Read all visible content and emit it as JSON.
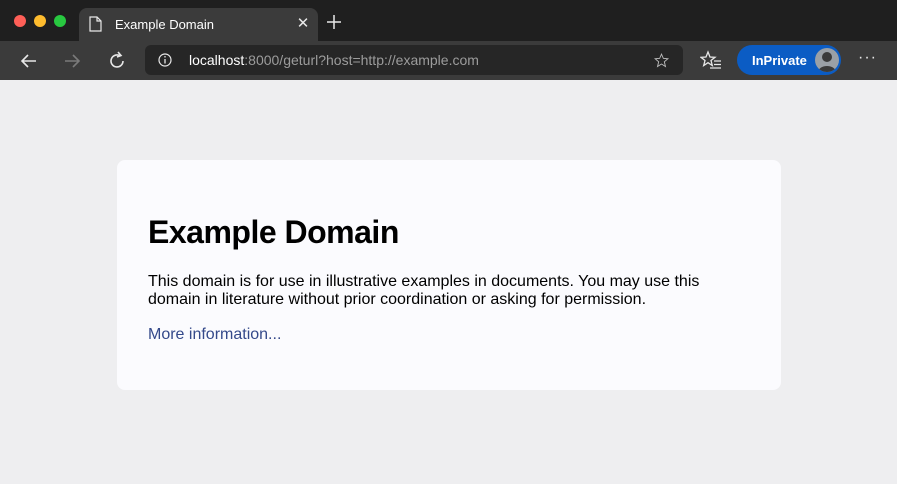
{
  "tab": {
    "title": "Example Domain",
    "close_glyph": "✕"
  },
  "toolbar": {
    "url_host": "localhost",
    "url_rest": ":8000/geturl?host=http://example.com",
    "profile_label": "InPrivate",
    "more_glyph": "···"
  },
  "page": {
    "heading": "Example Domain",
    "paragraph": "This domain is for use in illustrative examples in documents. You may use this domain in literature without prior coordination or asking for permission.",
    "link": "More information..."
  },
  "colors": {
    "titlebar": "#1f1f1f",
    "toolbar": "#3b3b3b",
    "inprivate": "#0b5cc4",
    "link": "#34498a",
    "page_bg": "#eeeef0",
    "card_bg": "#fbfbfe"
  },
  "icons": [
    "page-icon",
    "close-icon",
    "plus-icon",
    "back-arrow-icon",
    "forward-arrow-icon",
    "refresh-icon",
    "info-icon",
    "star-icon",
    "favorites-icon",
    "avatar",
    "more-icon"
  ]
}
